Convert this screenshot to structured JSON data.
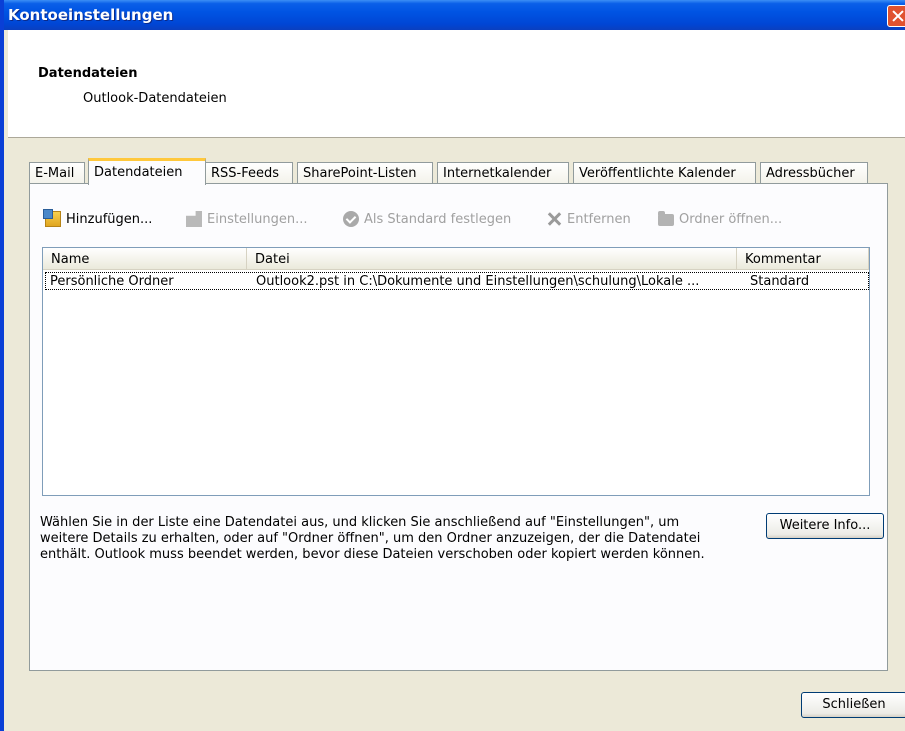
{
  "window": {
    "title": "Kontoeinstellungen"
  },
  "header": {
    "title": "Datendateien",
    "subtitle": "Outlook-Datendateien"
  },
  "tabs": [
    {
      "label": "E-Mail"
    },
    {
      "label": "Datendateien",
      "active": true
    },
    {
      "label": "RSS-Feeds"
    },
    {
      "label": "SharePoint-Listen"
    },
    {
      "label": "Internetkalender"
    },
    {
      "label": "Veröffentlichte Kalender"
    },
    {
      "label": "Adressbücher"
    }
  ],
  "toolbar": {
    "add": "Hinzufügen...",
    "settings": "Einstellungen...",
    "set_default": "Als Standard festlegen",
    "remove": "Entfernen",
    "open_folder": "Ordner öffnen..."
  },
  "list": {
    "columns": [
      "Name",
      "Datei",
      "Kommentar"
    ],
    "rows": [
      {
        "name": "Persönliche Ordner",
        "file": "Outlook2.pst in C:\\Dokumente und Einstellungen\\schulung\\Lokale ...",
        "comment": "Standard"
      }
    ]
  },
  "description": "Wählen Sie in der Liste eine Datendatei aus, und klicken Sie anschließend auf \"Einstellungen\", um weitere Details zu erhalten, oder auf \"Ordner öffnen\", um den Ordner anzuzeigen, der die Datendatei enthält. Outlook muss beendet werden, bevor diese Dateien verschoben oder kopiert werden können.",
  "buttons": {
    "more_info": "Weitere Info...",
    "close": "Schließen"
  },
  "colors": {
    "titlebar": "#0054e3",
    "dialog_bg": "#ece9d8",
    "active_tab_accent": "#ffc83c"
  }
}
